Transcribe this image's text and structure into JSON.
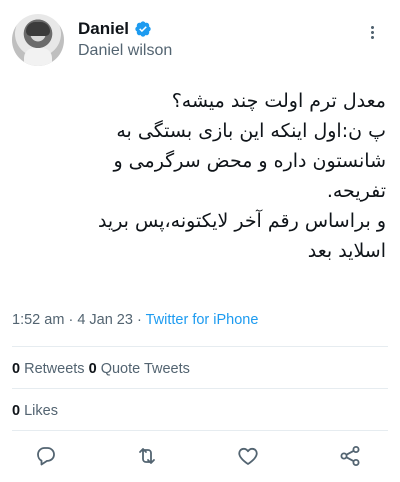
{
  "author": {
    "display_name": "Daniel",
    "handle": "Daniel wilson",
    "verified": true
  },
  "tweet": {
    "lines": [
      "معدل ترم اولت چند میشه؟",
      "پ ن:اول اینکه این بازی بستگی به",
      "شانستون داره و محض سرگرمی و",
      "تفریحه.",
      "و براساس رقم آخر لایکتونه،پس برید",
      "اسلاید بعد"
    ]
  },
  "meta": {
    "time": "1:52 am",
    "separator": "·",
    "date": "4 Jan 23",
    "source": "Twitter for iPhone"
  },
  "stats": {
    "retweets_count": "0",
    "retweets_label": "Retweets",
    "quotes_count": "0",
    "quotes_label": "Quote Tweets",
    "likes_count": "0",
    "likes_label": "Likes"
  },
  "colors": {
    "accent": "#1d9bf0",
    "muted": "#536471",
    "divider": "#e6ecf0"
  },
  "icons": [
    "verified-badge-icon",
    "more-options-icon",
    "reply-icon",
    "retweet-icon",
    "like-icon",
    "share-icon"
  ]
}
